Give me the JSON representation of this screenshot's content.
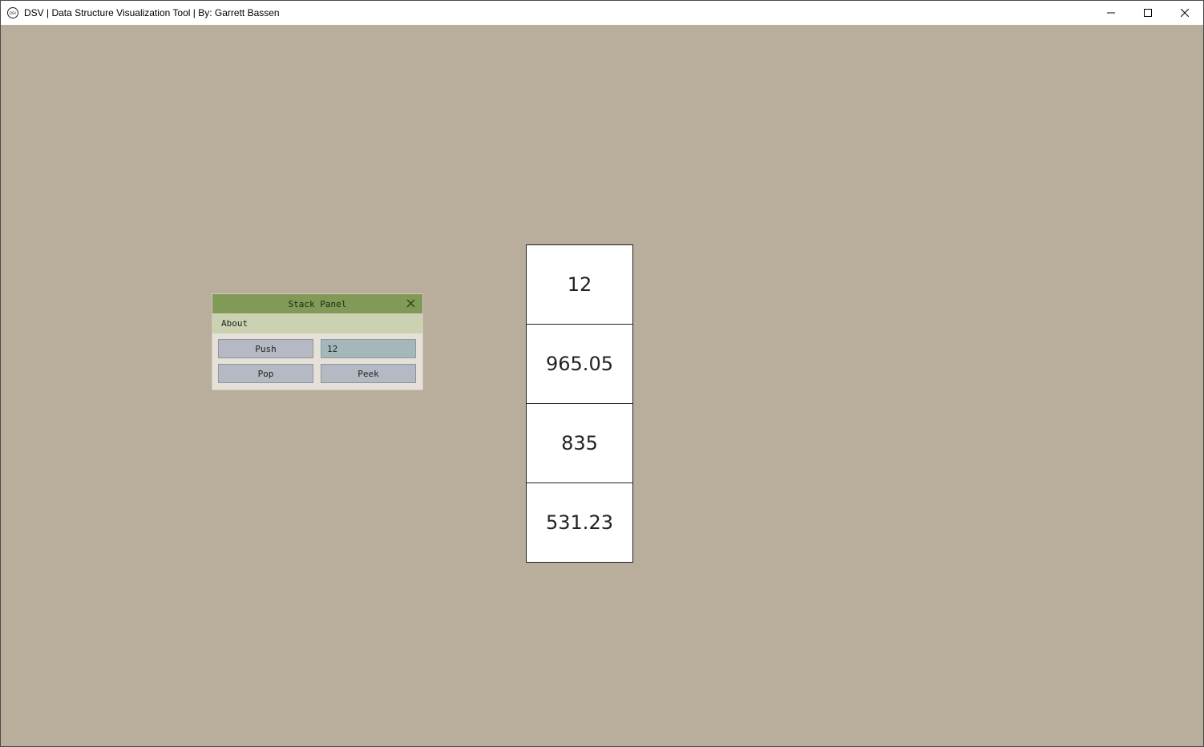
{
  "window": {
    "title": "DSV | Data Structure Visualization Tool | By: Garrett Bassen",
    "app_icon": "dsv-logo-icon",
    "controls": [
      "minimize-icon",
      "maximize-icon",
      "close-icon"
    ],
    "background_color": "#b9ad9b"
  },
  "panel": {
    "title": "Stack Panel",
    "close_icon": "close-icon",
    "header_color": "#829a58",
    "menu": [
      {
        "label": "About"
      }
    ],
    "push_label": "Push",
    "input_value": "12",
    "pop_label": "Pop",
    "peek_label": "Peek"
  },
  "stack": {
    "items": [
      "12",
      "965.05",
      "835",
      "531.23"
    ]
  }
}
